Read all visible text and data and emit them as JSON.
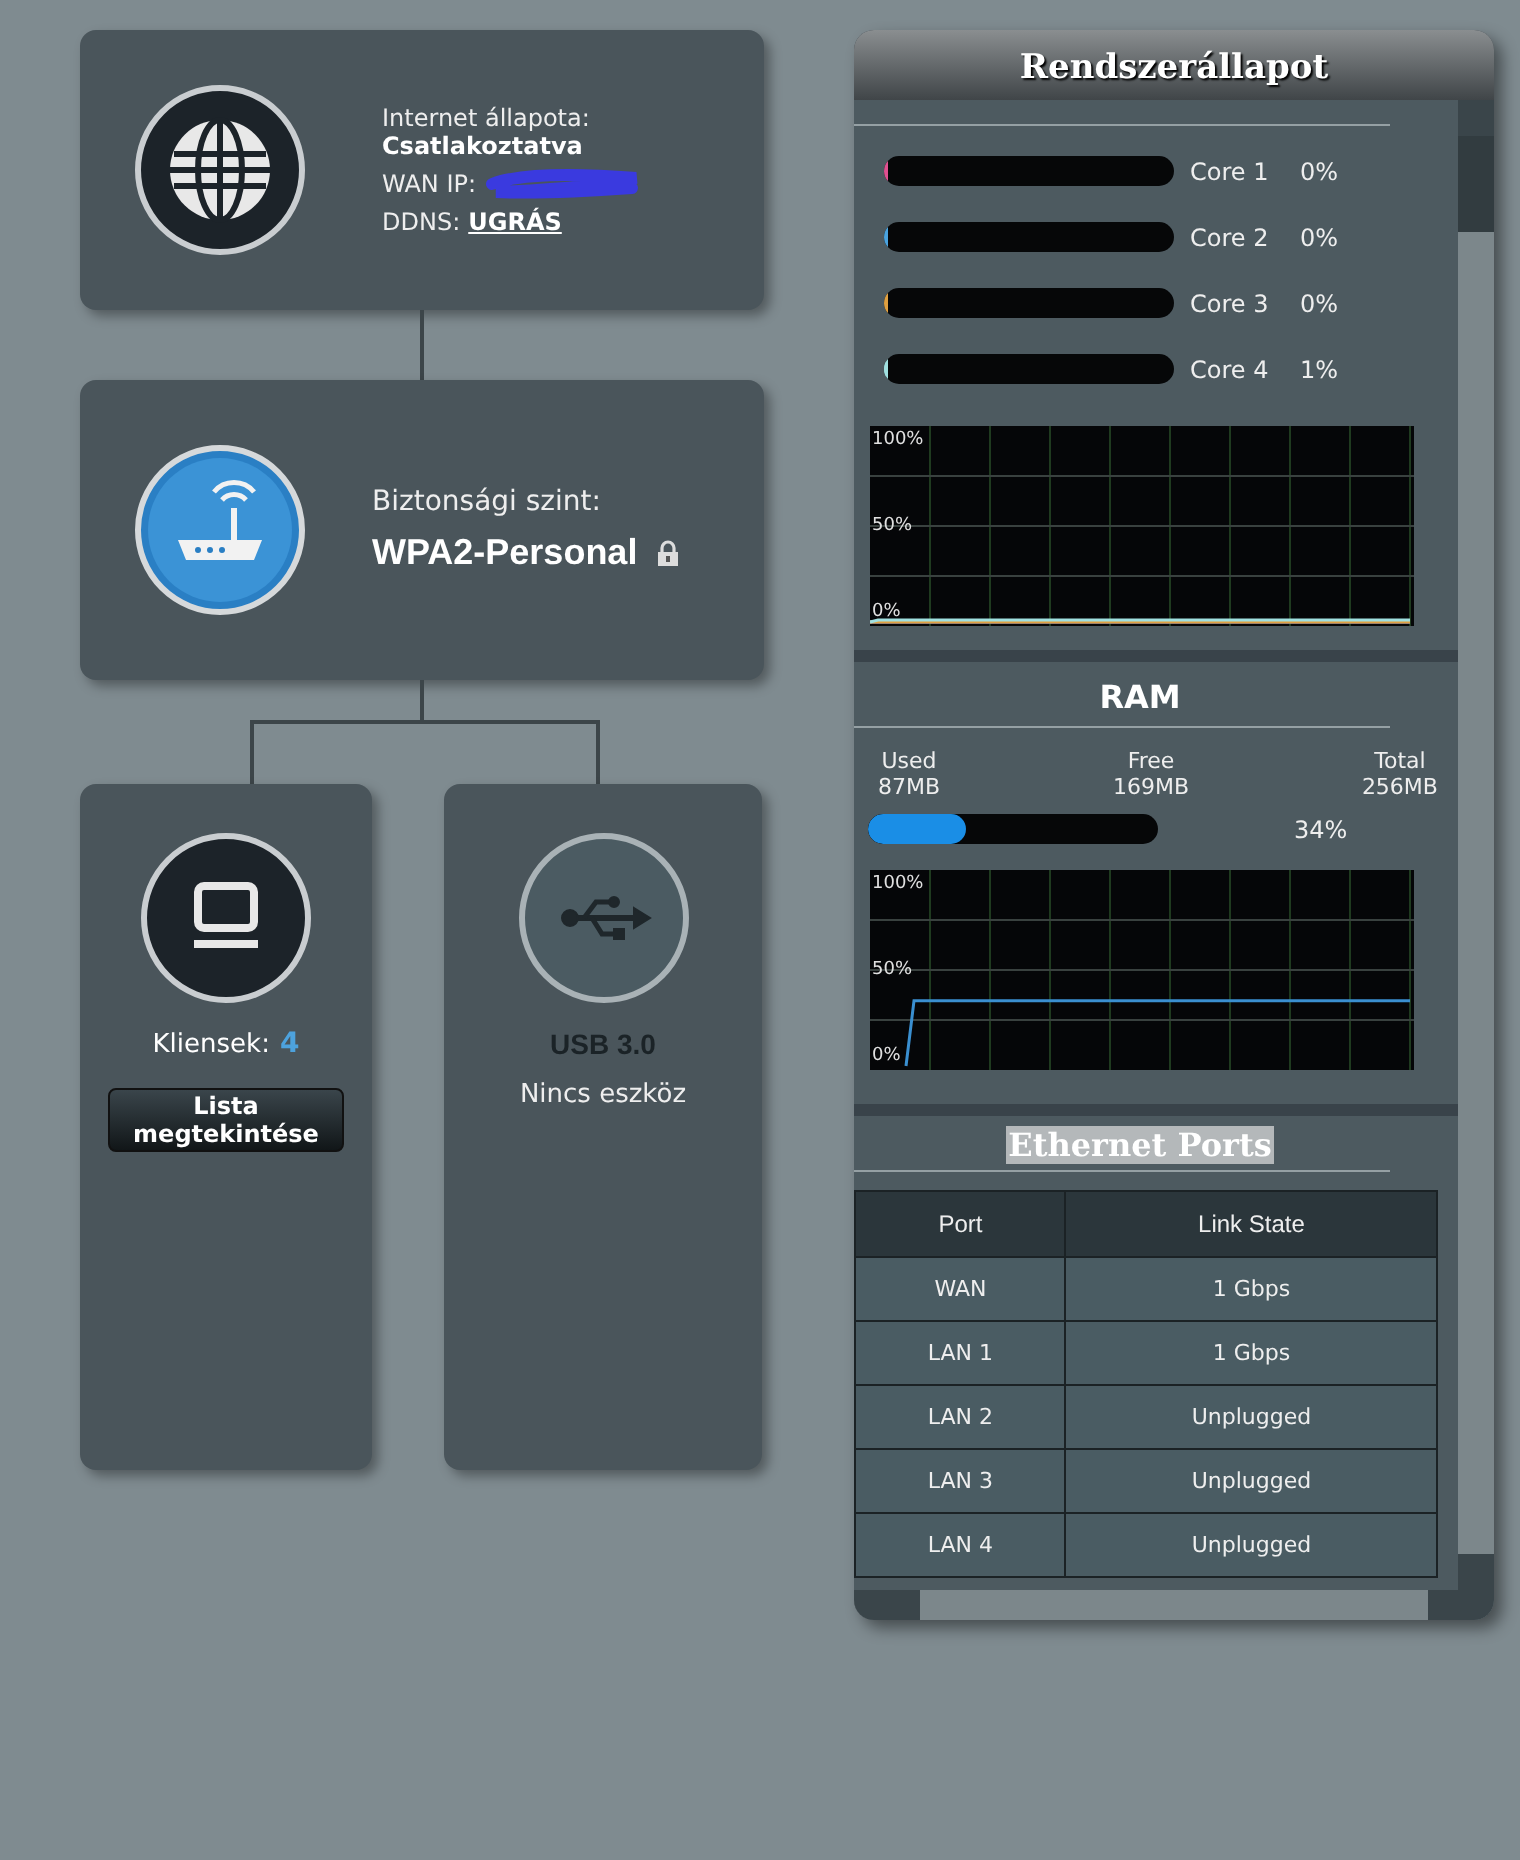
{
  "internet": {
    "status_label": "Internet állapota:",
    "status_value": "Csatlakoztatva",
    "wan_ip_label": "WAN IP:",
    "ddns_label": "DDNS:",
    "ddns_link": "UGRÁS"
  },
  "wireless": {
    "security_label": "Biztonsági szint:",
    "security_value": "WPA2-Personal",
    "locked": true
  },
  "clients": {
    "label": "Kliensek:",
    "count": "4",
    "button": "Lista megtekintése"
  },
  "usb": {
    "title": "USB 3.0",
    "status": "Nincs eszköz"
  },
  "panel": {
    "title": "Rendszerállapot",
    "cpu": {
      "cores": [
        {
          "name": "Core 1",
          "reading": "0%",
          "level": 0,
          "color": "#e05090"
        },
        {
          "name": "Core 2",
          "reading": "0%",
          "level": 0,
          "color": "#4aa3df"
        },
        {
          "name": "Core 3",
          "reading": "0%",
          "level": 0,
          "color": "#e0a040"
        },
        {
          "name": "Core 4",
          "reading": "1%",
          "level": 0.01,
          "color": "#a0e0e0"
        }
      ],
      "graph_labels": [
        "100%",
        "50%",
        "0%"
      ]
    },
    "ram": {
      "title": "RAM",
      "stats": [
        {
          "label": "Used",
          "value": "87MB"
        },
        {
          "label": "Free",
          "value": "169MB"
        },
        {
          "label": "Total",
          "value": "256MB"
        }
      ],
      "level": 0.34,
      "reading": "34%",
      "graph_labels": [
        "100%",
        "50%",
        "0%"
      ]
    },
    "ethernet": {
      "title": "Ethernet Ports",
      "columns": [
        "Port",
        "Link State"
      ],
      "rows": [
        [
          "WAN",
          "1 Gbps"
        ],
        [
          "LAN 1",
          "1 Gbps"
        ],
        [
          "LAN 2",
          "Unplugged"
        ],
        [
          "LAN 3",
          "Unplugged"
        ],
        [
          "LAN 4",
          "Unplugged"
        ]
      ]
    }
  }
}
